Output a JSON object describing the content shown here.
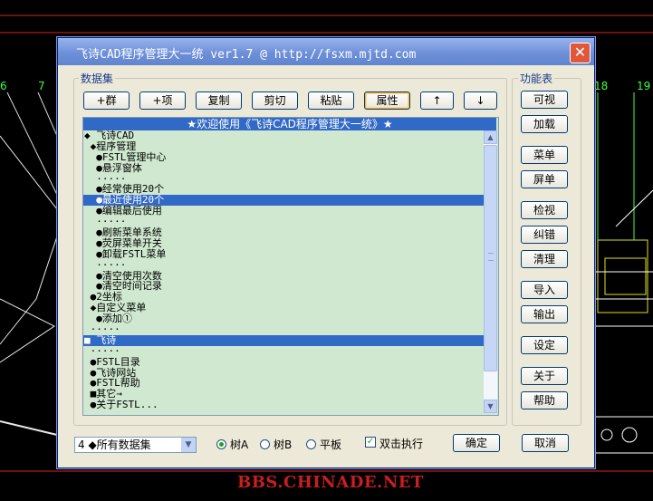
{
  "window": {
    "title": "飞诗CAD程序管理大一统 ver1.7 @ http://fsxm.mjtd.com"
  },
  "dataset": {
    "label": "数据集",
    "toolbar": [
      "+群",
      "+项",
      "复制",
      "剪切",
      "粘贴",
      "属性",
      "↑",
      "↓"
    ],
    "active_button": "属性",
    "list_header": "★欢迎使用《飞诗CAD程序管理大一统》★",
    "rows": [
      "◆ 飞诗CAD",
      " ◆程序管理",
      "  ●FSTL管理中心",
      "  ●悬浮窗体",
      "  ·····",
      "  ●经常使用20个",
      "  ●最近使用20个",
      "  ●编辑最后使用",
      "  ·····",
      "  ●刷新菜单系统",
      "  ●荧屏菜单开关",
      "  ●卸载FSTL菜单",
      "  ·····",
      "  ●清空使用次数",
      "  ●清空时间记录",
      " ●2坐标",
      " ◆自定义菜单",
      "  ●添加①",
      " ·····",
      "■ 飞诗",
      " ·····",
      " ●FSTL目录",
      " ●飞诗网站",
      " ●FSTL帮助",
      " ■其它→",
      " ●关于FSTL..."
    ],
    "selected_rows": [
      6,
      19
    ]
  },
  "bottom": {
    "combo_value": "4 ◆所有数据集",
    "radios": [
      {
        "label": "树A",
        "checked": true
      },
      {
        "label": "树B",
        "checked": false
      },
      {
        "label": "平板",
        "checked": false
      }
    ],
    "checkbox": {
      "label": "双击执行",
      "checked": true
    },
    "ok": "确定",
    "cancel": "取消"
  },
  "functions": {
    "label": "功能表",
    "buttons": [
      "可视",
      "加载",
      "菜单",
      "屏单",
      "检视",
      "纠错",
      "清理",
      "导入",
      "输出",
      "设定",
      "关于",
      "帮助"
    ]
  },
  "cad": {
    "labels": [
      "6",
      "7",
      "18",
      "19"
    ]
  },
  "watermark": "BBS.CHINADE.NET"
}
